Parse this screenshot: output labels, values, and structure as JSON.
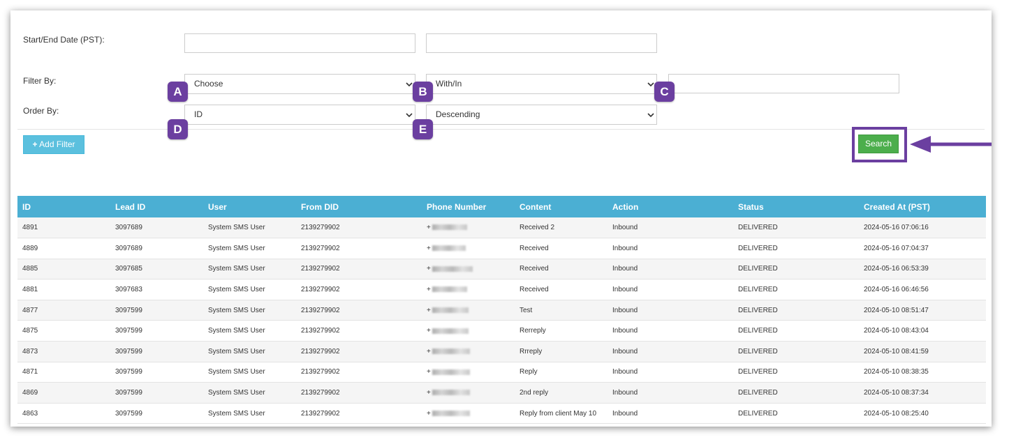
{
  "filters": {
    "date_label": "Start/End Date (PST):",
    "filter_by_label": "Filter By:",
    "order_by_label": "Order By:",
    "filter_field_selected": "Choose",
    "filter_operator_selected": "With/In",
    "filter_value": "",
    "order_field_selected": "ID",
    "order_direction_selected": "Descending",
    "start_date": "",
    "end_date": ""
  },
  "badges": {
    "a": "A",
    "b": "B",
    "c": "C",
    "d": "D",
    "e": "E"
  },
  "buttons": {
    "add_filter": "Add Filter",
    "search": "Search"
  },
  "colors": {
    "header": "#4bafd3",
    "badge": "#6b3fa0",
    "search": "#4cae4c",
    "add_filter": "#5bc0de"
  },
  "table": {
    "columns": [
      "ID",
      "Lead ID",
      "User",
      "From DID",
      "Phone Number",
      "Content",
      "Action",
      "Status",
      "Created At (PST)"
    ],
    "rows": [
      {
        "id": "4891",
        "lead_id": "3097689",
        "user": "System SMS User",
        "from_did": "2139279902",
        "phone": "+",
        "content": "Received 2",
        "action": "Inbound",
        "status": "DELIVERED",
        "created": "2024-05-16 07:06:16"
      },
      {
        "id": "4889",
        "lead_id": "3097689",
        "user": "System SMS User",
        "from_did": "2139279902",
        "phone": "+",
        "content": "Received",
        "action": "Inbound",
        "status": "DELIVERED",
        "created": "2024-05-16 07:04:37"
      },
      {
        "id": "4885",
        "lead_id": "3097685",
        "user": "System SMS User",
        "from_did": "2139279902",
        "phone": "+",
        "content": "Received",
        "action": "Inbound",
        "status": "DELIVERED",
        "created": "2024-05-16 06:53:39"
      },
      {
        "id": "4881",
        "lead_id": "3097683",
        "user": "System SMS User",
        "from_did": "2139279902",
        "phone": "+",
        "content": "Received",
        "action": "Inbound",
        "status": "DELIVERED",
        "created": "2024-05-16 06:46:56"
      },
      {
        "id": "4877",
        "lead_id": "3097599",
        "user": "System SMS User",
        "from_did": "2139279902",
        "phone": "+",
        "content": "Test",
        "action": "Inbound",
        "status": "DELIVERED",
        "created": "2024-05-10 08:51:47"
      },
      {
        "id": "4875",
        "lead_id": "3097599",
        "user": "System SMS User",
        "from_did": "2139279902",
        "phone": "+",
        "content": "Rerreply",
        "action": "Inbound",
        "status": "DELIVERED",
        "created": "2024-05-10 08:43:04"
      },
      {
        "id": "4873",
        "lead_id": "3097599",
        "user": "System SMS User",
        "from_did": "2139279902",
        "phone": "+",
        "content": "Rrreply",
        "action": "Inbound",
        "status": "DELIVERED",
        "created": "2024-05-10 08:41:59"
      },
      {
        "id": "4871",
        "lead_id": "3097599",
        "user": "System SMS User",
        "from_did": "2139279902",
        "phone": "+",
        "content": "Reply",
        "action": "Inbound",
        "status": "DELIVERED",
        "created": "2024-05-10 08:38:35"
      },
      {
        "id": "4869",
        "lead_id": "3097599",
        "user": "System SMS User",
        "from_did": "2139279902",
        "phone": "+",
        "content": "2nd reply",
        "action": "Inbound",
        "status": "DELIVERED",
        "created": "2024-05-10 08:37:34"
      },
      {
        "id": "4863",
        "lead_id": "3097599",
        "user": "System SMS User",
        "from_did": "2139279902",
        "phone": "+",
        "content": "Reply from client May 10",
        "action": "Inbound",
        "status": "DELIVERED",
        "created": "2024-05-10 08:25:40"
      }
    ]
  }
}
